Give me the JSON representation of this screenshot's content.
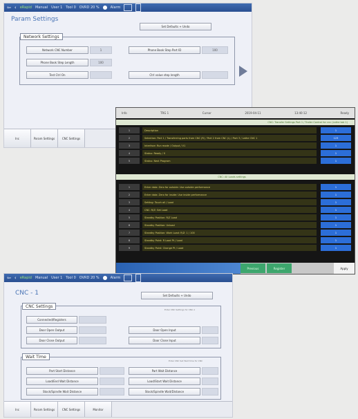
{
  "status_bar": {
    "back_icon": "back-arrow-icon",
    "mode": "eRapid",
    "items": [
      "Manual",
      "User 1",
      "Tool 0",
      "OVRD 20 %",
      "Alarm"
    ]
  },
  "screen1": {
    "title": "Param Settings",
    "top_button": "Set Defaults + Undo",
    "group_title": "Network Settings",
    "rows": [
      {
        "label": "Network CNC Number",
        "value": "1",
        "label2": "Phone Book Step Part ID",
        "value2": "100"
      },
      {
        "label": "Phone Book Step Length",
        "value": "100",
        "label2": "",
        "value2": ""
      },
      {
        "label": "Test Ctrl On",
        "value": "",
        "label2": "Ctrl value step length",
        "value2": ""
      }
    ],
    "tabs": [
      "Inc",
      "Param Settings",
      "CNC Settings"
    ]
  },
  "screen2": {
    "header": [
      "Info",
      "TRG 1",
      "Cursor",
      "2019-04-11",
      "13:40:12",
      "Ready"
    ],
    "section1": "CNC: Transfer Settings Part 1 / Trailer Control for cnc (Lathe tab 1)",
    "rows1": [
      {
        "num": "1",
        "desc": "Description",
        "val": "1"
      },
      {
        "num": "2",
        "desc": "Selection: Part 1 / Transferring parts from CNC (R) / Part 2 from CNC (L) / Part 3 / Lathe CNC 1",
        "val": "123"
      },
      {
        "num": "3",
        "desc": "Interface: Run mode / Output / V1",
        "val": "1"
      },
      {
        "num": "4",
        "desc": "Status: Ready / 0",
        "val": "1"
      },
      {
        "num": "5",
        "desc": "Status: Next Program",
        "val": "1"
      }
    ],
    "section2": "CNC: All Loads settings",
    "rows2": [
      {
        "num": "1",
        "desc": "Enter data: Zero for outside: Use outside performance",
        "val": "1"
      },
      {
        "num": "2",
        "desc": "Enter data: Zero for inside: Use inside performance",
        "val": "1"
      },
      {
        "num": "3",
        "desc": "Setting: Touch all / Load",
        "val": "1"
      },
      {
        "num": "4",
        "desc": "CNC: R/Z: Set Load",
        "val": "1"
      },
      {
        "num": "5",
        "desc": "Standby Position: R/Z Load",
        "val": "1"
      },
      {
        "num": "6",
        "desc": "Standby Position: Unload",
        "val": "1"
      },
      {
        "num": "7",
        "desc": "Standby Position: Work Load: R/Z: 1 / 100",
        "val": "1"
      },
      {
        "num": "8",
        "desc": "Standby Point: R Load Pt / Load",
        "val": "1"
      },
      {
        "num": "9",
        "desc": "Standby Point: Change Pt / Load",
        "val": "1"
      }
    ],
    "foot_btn1": "Previous",
    "foot_btn2": "Register",
    "apply": "Apply"
  },
  "screen3": {
    "title": "CNC - 1",
    "top_button": "Set Defaults + Undo",
    "group1_title": "CNC Settings",
    "group1_note": "Enter CNC Settings for CNC-1",
    "g1_rows": [
      {
        "label": "Connected/Registers",
        "label2": ""
      },
      {
        "label": "Door Open Output",
        "label2": "Door Open Input"
      },
      {
        "label": "Door Close Output",
        "label2": "Door Close Input"
      }
    ],
    "group2_title": "Wait Time",
    "group2_note": "Enter CNC Set Wait time for CNC",
    "g2_rows": [
      {
        "label": "Part Start Distance",
        "label2": "Part Wait Distance"
      },
      {
        "label": "Load/End Wait Distance",
        "label2": "Load/Start Wait Distance"
      },
      {
        "label": "Stock/Spindle Wait Distance",
        "label2": "Stock/Spindle Wait/Distance"
      }
    ],
    "tabs": [
      "Inc",
      "Param Settings",
      "CNC Settings",
      "Monitor"
    ]
  }
}
